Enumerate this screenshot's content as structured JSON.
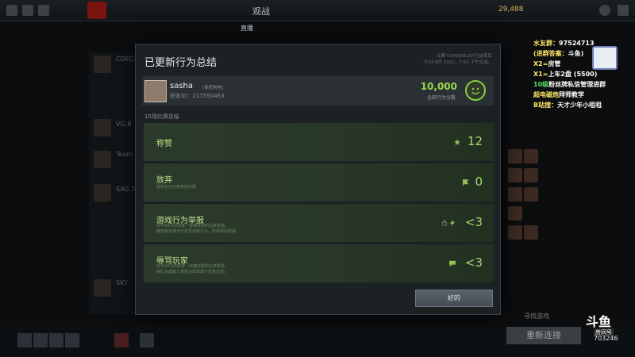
{
  "topnav": {
    "items": [
      "观战"
    ],
    "active": "观战"
  },
  "topbar": {
    "gold": "29,488"
  },
  "subnav": {
    "items": [
      "直播"
    ],
    "active": "直播"
  },
  "background": {
    "list_labels": [
      "CDEC.A",
      "VG.B",
      "Team M",
      "SAG.Te",
      "SKY"
    ],
    "right_label": "狼人"
  },
  "modal": {
    "title": "已更新行为总结",
    "match_info_line1": "比赛 6149836107已结束后",
    "match_info_line2": "于24.8月 2021，7:52 下午生成。",
    "profile": {
      "name": "sasha",
      "tag": "[保密狗狗]",
      "friend_id": "好友ID：217550463"
    },
    "score": {
      "value": "10,000",
      "label": "全部行为分数"
    },
    "section_label": "15场比赛总结",
    "rows": [
      {
        "title": "称赞",
        "desc1": "",
        "desc2": "",
        "value": "12",
        "icon": "star-icon"
      },
      {
        "title": "放弃",
        "desc1": "被标记为已放弃的次数",
        "desc2": "",
        "value": "0",
        "icon": "flag-icon"
      },
      {
        "title": "游戏行为举报",
        "desc1": "你与99%的玩家一样被举报的比率很低。",
        "desc2": "被玩家举报为干扰性游戏行为，所得到的结果。",
        "value": "<3",
        "icon": "lightning-icon"
      },
      {
        "title": "辱骂玩家",
        "desc1": "你与99%的玩家一样被举报的比率很低。",
        "desc2": "被队友或敌人举报为辱骂或干扰性交流。",
        "value": "<3",
        "icon": "chat-icon"
      }
    ],
    "ok_label": "好的"
  },
  "sidebar_right": {
    "reconnect": "重新连接",
    "find_game": "寻找游戏"
  },
  "stream_overlay": {
    "lines": [
      {
        "k": "水友群：",
        "v": "97524713"
      },
      {
        "k": "(进群答案：",
        "v": "斗鱼)"
      },
      {
        "k": "X2=",
        "v": "房管"
      },
      {
        "k": "X1=",
        "v": "上车2盘 (5500)"
      },
      {
        "k": "10级",
        "v": "粉丝牌私信管理进群"
      },
      {
        "k": "超电磁炮",
        "v": "拜师教学"
      },
      {
        "k": "B站搜：",
        "v": "天才少年小咀咀"
      }
    ],
    "douyu": "斗鱼",
    "room_label": "房间号",
    "room_number": "703246"
  }
}
